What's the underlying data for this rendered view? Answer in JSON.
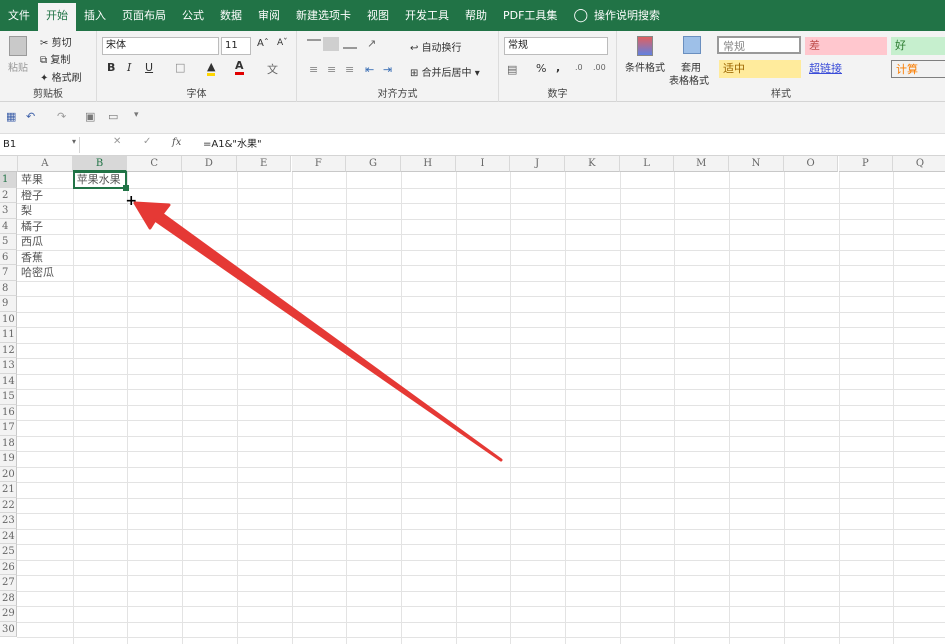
{
  "menu": {
    "items": [
      "文件",
      "开始",
      "插入",
      "页面布局",
      "公式",
      "数据",
      "审阅",
      "新建选项卡",
      "视图",
      "开发工具",
      "帮助",
      "PDF工具集"
    ],
    "tell_me": "操作说明搜索"
  },
  "ribbon": {
    "clipboard": {
      "paste": "粘贴",
      "cut": "剪切",
      "copy": "复制",
      "format_painter": "格式刷",
      "label": "剪贴板"
    },
    "font": {
      "name": "宋体",
      "size": "11",
      "label": "字体"
    },
    "align": {
      "wrap": "自动换行",
      "merge": "合并后居中",
      "label": "对齐方式"
    },
    "number": {
      "format": "常规",
      "percent": "%",
      "comma": ",",
      "label": "数字"
    },
    "styles": {
      "cond": "条件格式",
      "table_l1": "套用",
      "table_l2": "表格格式",
      "normal": "常规",
      "bad": "差",
      "good": "好",
      "neutral": "适中",
      "hyperlink": "超链接",
      "calc": "计算",
      "label": "样式"
    }
  },
  "formula_bar": {
    "name_box": "B1",
    "fx": "fx",
    "formula": "=A1&\"水果\""
  },
  "sheet": {
    "columns": [
      "A",
      "B",
      "C",
      "D",
      "E",
      "F",
      "G",
      "H",
      "I",
      "J",
      "K",
      "L",
      "M",
      "N",
      "O",
      "P",
      "Q"
    ],
    "rows": [
      "1",
      "2",
      "3",
      "4",
      "5",
      "6",
      "7",
      "8",
      "9",
      "10",
      "11",
      "12",
      "13",
      "14",
      "15",
      "16",
      "17",
      "18",
      "19",
      "20",
      "21",
      "22",
      "23",
      "24",
      "25",
      "26",
      "27",
      "28",
      "29",
      "30"
    ],
    "col_a": [
      "苹果",
      "橙子",
      "梨",
      "橘子",
      "西瓜",
      "香蕉",
      "哈密瓜"
    ],
    "b1": "苹果水果"
  },
  "colors": {
    "accent": "#217346",
    "arrow": "#e53935"
  }
}
